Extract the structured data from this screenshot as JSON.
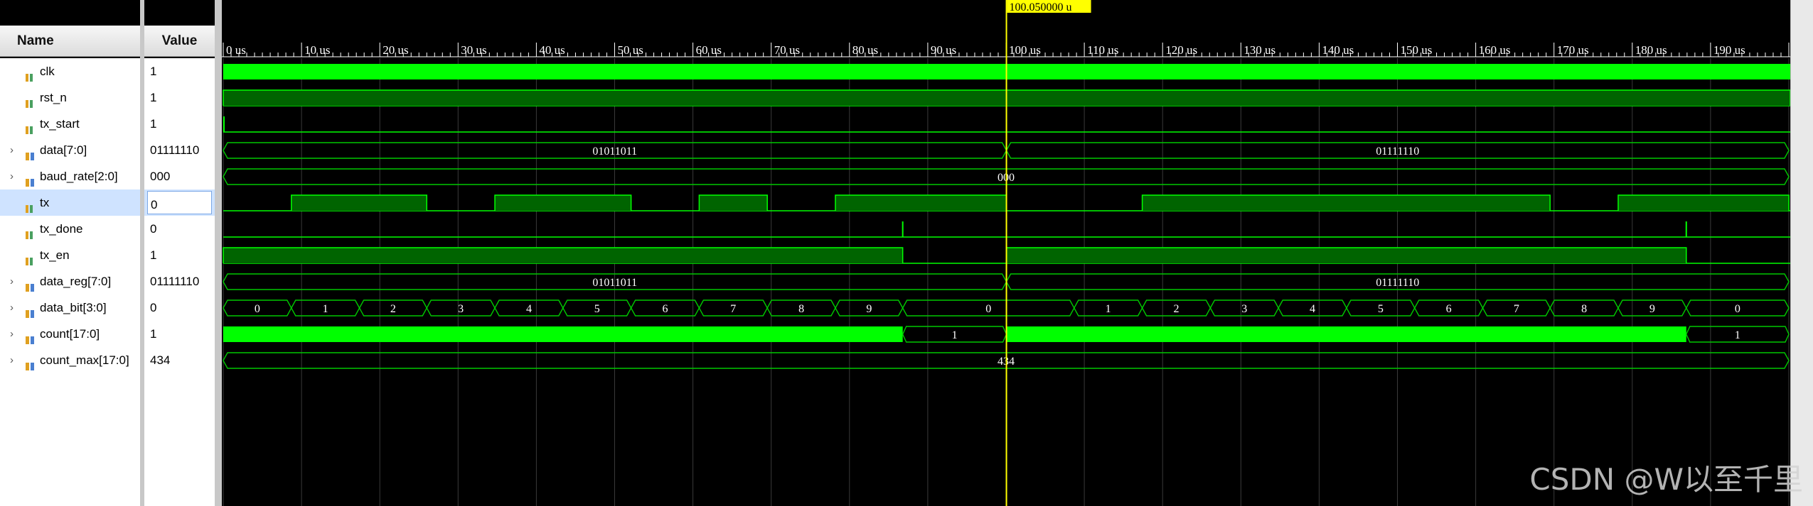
{
  "columns": {
    "name": "Name",
    "value": "Value"
  },
  "signals": [
    {
      "name": "clk",
      "value": "1",
      "kind": "bit",
      "expandable": false,
      "selected": false
    },
    {
      "name": "rst_n",
      "value": "1",
      "kind": "bit",
      "expandable": false,
      "selected": false
    },
    {
      "name": "tx_start",
      "value": "1",
      "kind": "bit",
      "expandable": false,
      "selected": false
    },
    {
      "name": "data[7:0]",
      "value": "01111110",
      "kind": "bus",
      "expandable": true,
      "selected": false
    },
    {
      "name": "baud_rate[2:0]",
      "value": "000",
      "kind": "bus",
      "expandable": true,
      "selected": false
    },
    {
      "name": "tx",
      "value": "0",
      "kind": "bit",
      "expandable": false,
      "selected": true
    },
    {
      "name": "tx_done",
      "value": "0",
      "kind": "bit",
      "expandable": false,
      "selected": false
    },
    {
      "name": "tx_en",
      "value": "1",
      "kind": "bit",
      "expandable": false,
      "selected": false
    },
    {
      "name": "data_reg[7:0]",
      "value": "01111110",
      "kind": "bus",
      "expandable": true,
      "selected": false
    },
    {
      "name": "data_bit[3:0]",
      "value": "0",
      "kind": "bus",
      "expandable": true,
      "selected": false
    },
    {
      "name": "count[17:0]",
      "value": "1",
      "kind": "bus",
      "expandable": true,
      "selected": false
    },
    {
      "name": "count_max[17:0]",
      "value": "434",
      "kind": "bus",
      "expandable": true,
      "selected": false
    }
  ],
  "ruler": {
    "unit": "us",
    "labels": [
      "0 us",
      "10 us",
      "20 us",
      "30 us",
      "40 us",
      "50 us",
      "60 us",
      "70 us",
      "80 us",
      "90 us",
      "100 us",
      "110 us",
      "120 us",
      "130 us",
      "140 us",
      "150 us",
      "160 us",
      "170 us",
      "180 us",
      "190 us"
    ]
  },
  "cursor": {
    "time_us": 100.05,
    "label": "100.050000 u"
  },
  "waveforms": {
    "clk": {
      "type": "clock"
    },
    "rst_n": {
      "type": "level",
      "level": 1
    },
    "tx_start": {
      "type": "pulse_at_start"
    },
    "data": {
      "type": "bus",
      "segments": [
        {
          "from": 0,
          "to": 100.05,
          "label": "01011011"
        },
        {
          "from": 100.05,
          "to": 200,
          "label": "01111110"
        }
      ]
    },
    "baud_rate": {
      "type": "bus",
      "segments": [
        {
          "from": 0,
          "to": 200,
          "label": "000"
        }
      ]
    },
    "tx": {
      "type": "bits",
      "high_spans": [
        [
          8.7,
          26.0
        ],
        [
          34.7,
          52.1
        ],
        [
          60.8,
          69.5
        ],
        [
          78.2,
          100.05
        ],
        [
          117.4,
          169.5
        ],
        [
          178.2,
          200
        ]
      ]
    },
    "tx_done": {
      "type": "pulses",
      "at": [
        86.8,
        186.9
      ]
    },
    "tx_en": {
      "type": "bits",
      "high_spans": [
        [
          0,
          86.8
        ],
        [
          100.05,
          186.9
        ]
      ]
    },
    "data_reg": {
      "type": "bus",
      "segments": [
        {
          "from": 0,
          "to": 100.05,
          "label": "01011011"
        },
        {
          "from": 100.05,
          "to": 200,
          "label": "01111110"
        }
      ]
    },
    "data_bit": {
      "type": "bus",
      "segments": [
        {
          "from": 0,
          "to": 8.7,
          "label": "0"
        },
        {
          "from": 8.7,
          "to": 17.4,
          "label": "1"
        },
        {
          "from": 17.4,
          "to": 26.0,
          "label": "2"
        },
        {
          "from": 26.0,
          "to": 34.7,
          "label": "3"
        },
        {
          "from": 34.7,
          "to": 43.4,
          "label": "4"
        },
        {
          "from": 43.4,
          "to": 52.1,
          "label": "5"
        },
        {
          "from": 52.1,
          "to": 60.8,
          "label": "6"
        },
        {
          "from": 60.8,
          "to": 69.5,
          "label": "7"
        },
        {
          "from": 69.5,
          "to": 78.2,
          "label": "8"
        },
        {
          "from": 78.2,
          "to": 86.8,
          "label": "9"
        },
        {
          "from": 86.8,
          "to": 108.7,
          "label": "0"
        },
        {
          "from": 108.7,
          "to": 117.4,
          "label": "1"
        },
        {
          "from": 117.4,
          "to": 126.1,
          "label": "2"
        },
        {
          "from": 126.1,
          "to": 134.8,
          "label": "3"
        },
        {
          "from": 134.8,
          "to": 143.5,
          "label": "4"
        },
        {
          "from": 143.5,
          "to": 152.2,
          "label": "5"
        },
        {
          "from": 152.2,
          "to": 160.9,
          "label": "6"
        },
        {
          "from": 160.9,
          "to": 169.5,
          "label": "7"
        },
        {
          "from": 169.5,
          "to": 178.2,
          "label": "8"
        },
        {
          "from": 178.2,
          "to": 186.9,
          "label": "9"
        },
        {
          "from": 186.9,
          "to": 200,
          "label": "0"
        }
      ]
    },
    "count": {
      "type": "counter",
      "busy_spans": [
        [
          0,
          86.8
        ],
        [
          100.05,
          186.9
        ]
      ],
      "idle_segments": [
        {
          "from": 86.8,
          "to": 100.05,
          "label": "1"
        },
        {
          "from": 186.9,
          "to": 200,
          "label": "1"
        }
      ]
    },
    "count_max": {
      "type": "bus",
      "segments": [
        {
          "from": 0,
          "to": 200,
          "label": "434"
        }
      ]
    }
  },
  "colors": {
    "wave": "#00ff00",
    "wave_fill": "#006400",
    "cursor": "#ffff00",
    "grid": "#3a3a3a",
    "bus_outline": "#00c800"
  },
  "watermark": "CSDN @W以至千里"
}
